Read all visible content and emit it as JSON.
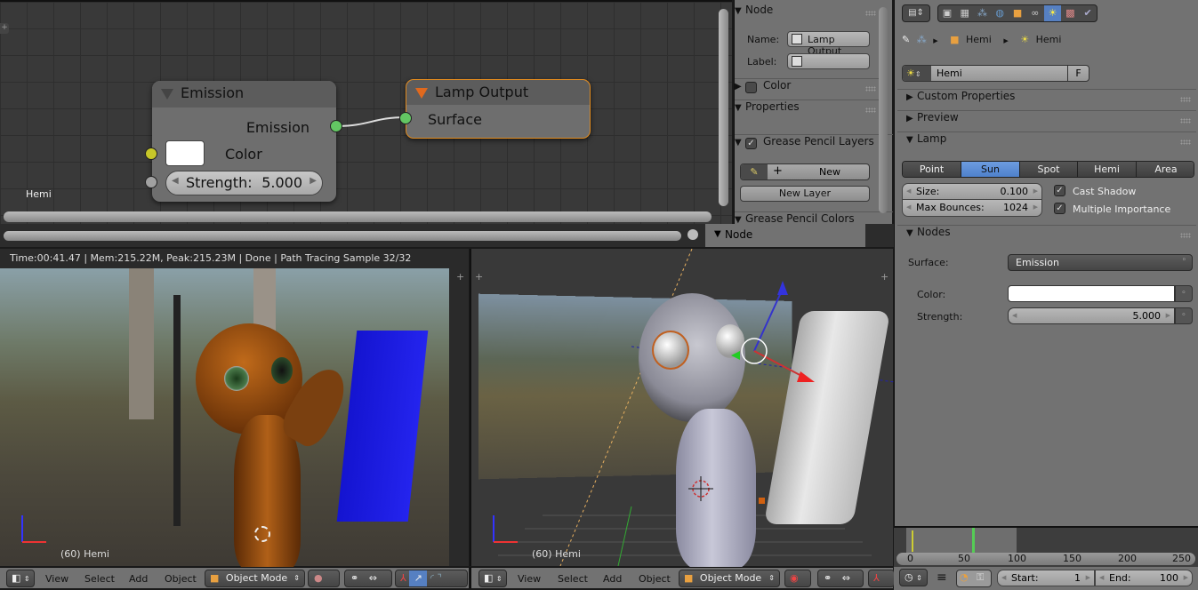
{
  "node_editor": {
    "material_label": "Hemi",
    "nodes": {
      "emission": {
        "title": "Emission",
        "output_label": "Emission",
        "color_label": "Color",
        "color_value": "#ffffff",
        "strength_label": "Strength:",
        "strength_value": "5.000"
      },
      "lamp_output": {
        "title": "Lamp Output",
        "input_label": "Surface"
      }
    },
    "socket_colors": {
      "shader": "#63c763",
      "color": "#c7c729",
      "value": "#a1a1a1"
    }
  },
  "n_panel": {
    "node_section": "Node",
    "name_label": "Name:",
    "name_value": "Lamp Output",
    "label_label": "Label:",
    "label_value": "",
    "color_section": "Color",
    "properties_section": "Properties",
    "grease_layers_section": "Grease Pencil Layers",
    "new_button": "New",
    "new_layer_button": "New Layer",
    "grease_colors_section": "Grease Pencil Colors",
    "footer_label": "Node"
  },
  "render_view": {
    "status": "Time:00:41.47 | Mem:215.22M, Peak:215.23M | Done | Path Tracing Sample 32/32",
    "object_label": "(60) Hemi"
  },
  "viewport3d": {
    "object_label": "(60) Hemi"
  },
  "header_left": {
    "menus": [
      "View",
      "Select",
      "Add",
      "Object"
    ],
    "mode": "Object Mode"
  },
  "header_right": {
    "menus": [
      "View",
      "Select",
      "Add",
      "Object"
    ],
    "mode": "Object Mode"
  },
  "properties": {
    "breadcrumb": [
      "Hemi",
      "Hemi"
    ],
    "datablock_name": "Hemi",
    "fake_user": "F",
    "sections": {
      "custom_props": "Custom Properties",
      "preview": "Preview",
      "lamp": "Lamp",
      "nodes": "Nodes"
    },
    "lamp_types": [
      "Point",
      "Sun",
      "Spot",
      "Hemi",
      "Area"
    ],
    "selected_lamp_type": "Sun",
    "size_label": "Size:",
    "size_value": "0.100",
    "bounces_label": "Max Bounces:",
    "bounces_value": "1024",
    "cast_shadow": "Cast Shadow",
    "cast_shadow_checked": true,
    "multiple_importance": "Multiple Importance",
    "multiple_importance_checked": true,
    "surface_label": "Surface:",
    "surface_value": "Emission",
    "color_label": "Color:",
    "color_value": "#ffffff",
    "strength_label": "Strength:",
    "strength_value": "5.000"
  },
  "timeline": {
    "ticks": [
      "0",
      "50",
      "100",
      "150",
      "200",
      "250"
    ],
    "current_frame": 60,
    "start_label": "Start:",
    "start_value": "1",
    "end_label": "End:",
    "end_value": "100"
  }
}
